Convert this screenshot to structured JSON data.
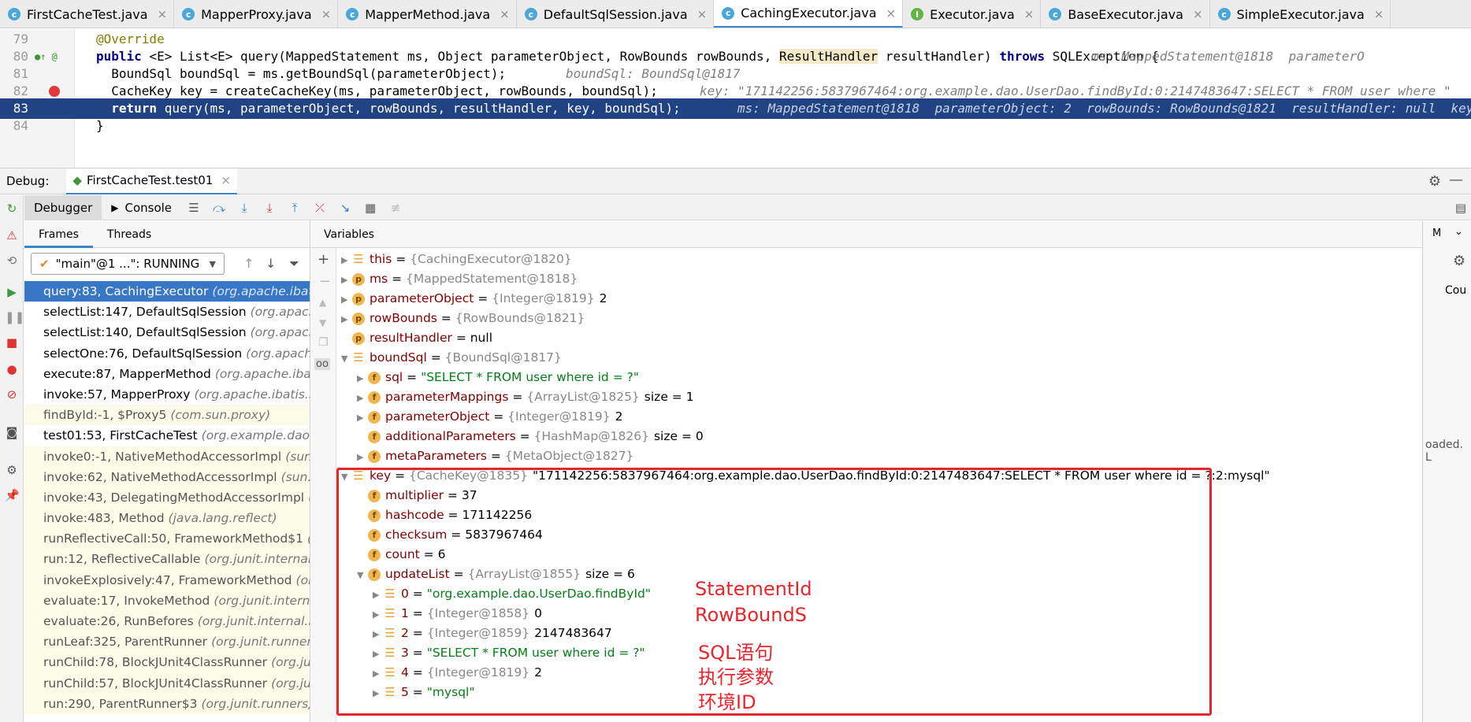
{
  "tabs": [
    {
      "label": "FirstCacheTest.java",
      "icon": "c",
      "active": false
    },
    {
      "label": "MapperProxy.java",
      "icon": "c",
      "active": false
    },
    {
      "label": "MapperMethod.java",
      "icon": "c",
      "active": false
    },
    {
      "label": "DefaultSqlSession.java",
      "icon": "c",
      "active": false
    },
    {
      "label": "CachingExecutor.java",
      "icon": "c",
      "active": true
    },
    {
      "label": "Executor.java",
      "icon": "i",
      "active": false
    },
    {
      "label": "BaseExecutor.java",
      "icon": "c",
      "active": false
    },
    {
      "label": "SimpleExecutor.java",
      "icon": "c",
      "active": false
    }
  ],
  "editor": {
    "lines": [
      {
        "num": "79",
        "code": "@Override",
        "type": "ann"
      },
      {
        "num": "80",
        "code": "public <E> List<E> query(MappedStatement ms, Object parameterObject, RowBounds rowBounds, ResultHandler resultHandler) throws SQLException {",
        "hint": "ms: MappedStatement@1818  parameterO"
      },
      {
        "num": "81",
        "code": "  BoundSql boundSql = ms.getBoundSql(parameterObject);",
        "hint": "boundSql: BoundSql@1817"
      },
      {
        "num": "82",
        "code": "  CacheKey key = createCacheKey(ms, parameterObject, rowBounds, boundSql);",
        "hint": "key: \"171142256:5837967464:org.example.dao.UserDao.findById:0:2147483647:SELECT * FROM user where \""
      },
      {
        "num": "83",
        "code": "  return query(ms, parameterObject, rowBounds, resultHandler, key, boundSql);",
        "hint": "ms: MappedStatement@1818  parameterObject: 2  rowBounds: RowBounds@1821  resultHandler: null  key"
      },
      {
        "num": "84",
        "code": "}"
      }
    ]
  },
  "debug": {
    "label": "Debug:",
    "session_tab": "FirstCacheTest.test01",
    "toolbar": {
      "debugger": "Debugger",
      "console": "Console"
    },
    "frames_tab": "Frames",
    "threads_tab": "Threads",
    "thread_select": "\"main\"@1 ...\": RUNNING",
    "variables_header": "Variables",
    "right_tab": "M",
    "right_label": "Cou",
    "right_trunc": "oaded. L"
  },
  "frames": [
    {
      "method": "query:83, CachingExecutor",
      "pkg": "(org.apache.ibatis.e",
      "state": "sel"
    },
    {
      "method": "selectList:147, DefaultSqlSession",
      "pkg": "(org.apache.ib",
      "state": "normal"
    },
    {
      "method": "selectList:140, DefaultSqlSession",
      "pkg": "(org.apache.ib",
      "state": "normal"
    },
    {
      "method": "selectOne:76, DefaultSqlSession",
      "pkg": "(org.apache.ib",
      "state": "normal"
    },
    {
      "method": "execute:87, MapperMethod",
      "pkg": "(org.apache.ibatis",
      "state": "normal"
    },
    {
      "method": "invoke:57, MapperProxy",
      "pkg": "(org.apache.ibatis.bin",
      "state": "normal"
    },
    {
      "method": "findById:-1, $Proxy5",
      "pkg": "(com.sun.proxy)",
      "state": "lib"
    },
    {
      "method": "test01:53, FirstCacheTest",
      "pkg": "(org.example.dao.te",
      "state": "normal"
    },
    {
      "method": "invoke0:-1, NativeMethodAccessorImpl",
      "pkg": "(sun.re",
      "state": "lib"
    },
    {
      "method": "invoke:62, NativeMethodAccessorImpl",
      "pkg": "(sun.re",
      "state": "lib"
    },
    {
      "method": "invoke:43, DelegatingMethodAccessorImpl",
      "pkg": "(su",
      "state": "lib"
    },
    {
      "method": "invoke:483, Method",
      "pkg": "(java.lang.reflect)",
      "state": "lib"
    },
    {
      "method": "runReflectiveCall:50, FrameworkMethod$1",
      "pkg": "(or",
      "state": "lib"
    },
    {
      "method": "run:12, ReflectiveCallable",
      "pkg": "(org.junit.internal.ru",
      "state": "lib"
    },
    {
      "method": "invokeExplosively:47, FrameworkMethod",
      "pkg": "(org.ju",
      "state": "lib"
    },
    {
      "method": "evaluate:17, InvokeMethod",
      "pkg": "(org.junit.internal.r",
      "state": "lib"
    },
    {
      "method": "evaluate:26, RunBefores",
      "pkg": "(org.junit.internal.runi",
      "state": "lib"
    },
    {
      "method": "runLeaf:325, ParentRunner",
      "pkg": "(org.junit.runners)",
      "state": "lib"
    },
    {
      "method": "runChild:78, BlockJUnit4ClassRunner",
      "pkg": "(org.junit.",
      "state": "lib"
    },
    {
      "method": "runChild:57, BlockJUnit4ClassRunner",
      "pkg": "(org.junit.",
      "state": "lib"
    },
    {
      "method": "run:290, ParentRunner$3",
      "pkg": "(org.junit.runners)",
      "state": "lib"
    }
  ],
  "variables": [
    {
      "depth": 0,
      "arrow": "right",
      "icon": "list",
      "name": "this",
      "ref": "{CachingExecutor@1820}",
      "value": ""
    },
    {
      "depth": 0,
      "arrow": "right",
      "icon": "p",
      "name": "ms",
      "ref": "{MappedStatement@1818}",
      "value": ""
    },
    {
      "depth": 0,
      "arrow": "right",
      "icon": "p",
      "name": "parameterObject",
      "ref": "{Integer@1819}",
      "value": "2"
    },
    {
      "depth": 0,
      "arrow": "right",
      "icon": "p",
      "name": "rowBounds",
      "ref": "{RowBounds@1821}",
      "value": ""
    },
    {
      "depth": 0,
      "arrow": "",
      "icon": "p",
      "name": "resultHandler",
      "ref": "",
      "value": "null"
    },
    {
      "depth": 0,
      "arrow": "down",
      "icon": "list",
      "name": "boundSql",
      "ref": "{BoundSql@1817}",
      "value": ""
    },
    {
      "depth": 1,
      "arrow": "right",
      "icon": "f",
      "name": "sql",
      "ref": "",
      "value": "\"SELECT * FROM user where id = ?\"",
      "str": true
    },
    {
      "depth": 1,
      "arrow": "right",
      "icon": "f",
      "name": "parameterMappings",
      "ref": "{ArrayList@1825}",
      "value": "size = 1"
    },
    {
      "depth": 1,
      "arrow": "right",
      "icon": "f",
      "name": "parameterObject",
      "ref": "{Integer@1819}",
      "value": "2"
    },
    {
      "depth": 1,
      "arrow": "",
      "icon": "f",
      "name": "additionalParameters",
      "ref": "{HashMap@1826}",
      "value": "size = 0"
    },
    {
      "depth": 1,
      "arrow": "right",
      "icon": "f",
      "name": "metaParameters",
      "ref": "{MetaObject@1827}",
      "value": ""
    },
    {
      "depth": 0,
      "arrow": "down",
      "icon": "list",
      "name": "key",
      "ref": "{CacheKey@1835}",
      "value": "\"171142256:5837967464:org.example.dao.UserDao.findById:0:2147483647:SELECT * FROM user where id = ?:2:mysql\""
    },
    {
      "depth": 1,
      "arrow": "",
      "icon": "f",
      "name": "multiplier",
      "ref": "",
      "value": "37"
    },
    {
      "depth": 1,
      "arrow": "",
      "icon": "f",
      "name": "hashcode",
      "ref": "",
      "value": "171142256"
    },
    {
      "depth": 1,
      "arrow": "",
      "icon": "f",
      "name": "checksum",
      "ref": "",
      "value": "5837967464"
    },
    {
      "depth": 1,
      "arrow": "",
      "icon": "f",
      "name": "count",
      "ref": "",
      "value": "6"
    },
    {
      "depth": 1,
      "arrow": "down",
      "icon": "f",
      "name": "updateList",
      "ref": "{ArrayList@1855}",
      "value": "size = 6"
    },
    {
      "depth": 2,
      "arrow": "right",
      "icon": "list",
      "name": "0",
      "ref": "",
      "value": "\"org.example.dao.UserDao.findById\"",
      "str": true
    },
    {
      "depth": 2,
      "arrow": "right",
      "icon": "list",
      "name": "1",
      "ref": "{Integer@1858}",
      "value": "0"
    },
    {
      "depth": 2,
      "arrow": "right",
      "icon": "list",
      "name": "2",
      "ref": "{Integer@1859}",
      "value": "2147483647"
    },
    {
      "depth": 2,
      "arrow": "right",
      "icon": "list",
      "name": "3",
      "ref": "",
      "value": "\"SELECT * FROM user where id = ?\"",
      "str": true
    },
    {
      "depth": 2,
      "arrow": "right",
      "icon": "list",
      "name": "4",
      "ref": "{Integer@1819}",
      "value": "2"
    },
    {
      "depth": 2,
      "arrow": "right",
      "icon": "list",
      "name": "5",
      "ref": "",
      "value": "\"mysql\"",
      "str": true
    }
  ],
  "annotations": [
    "StatementId",
    "RowBoundS",
    "SQL语句",
    "执行参数",
    "环境ID"
  ],
  "colors": {
    "accent": "#4083c9",
    "selection": "#3777c6",
    "annotation_red": "#e8252c",
    "exec_line": "#214283"
  }
}
